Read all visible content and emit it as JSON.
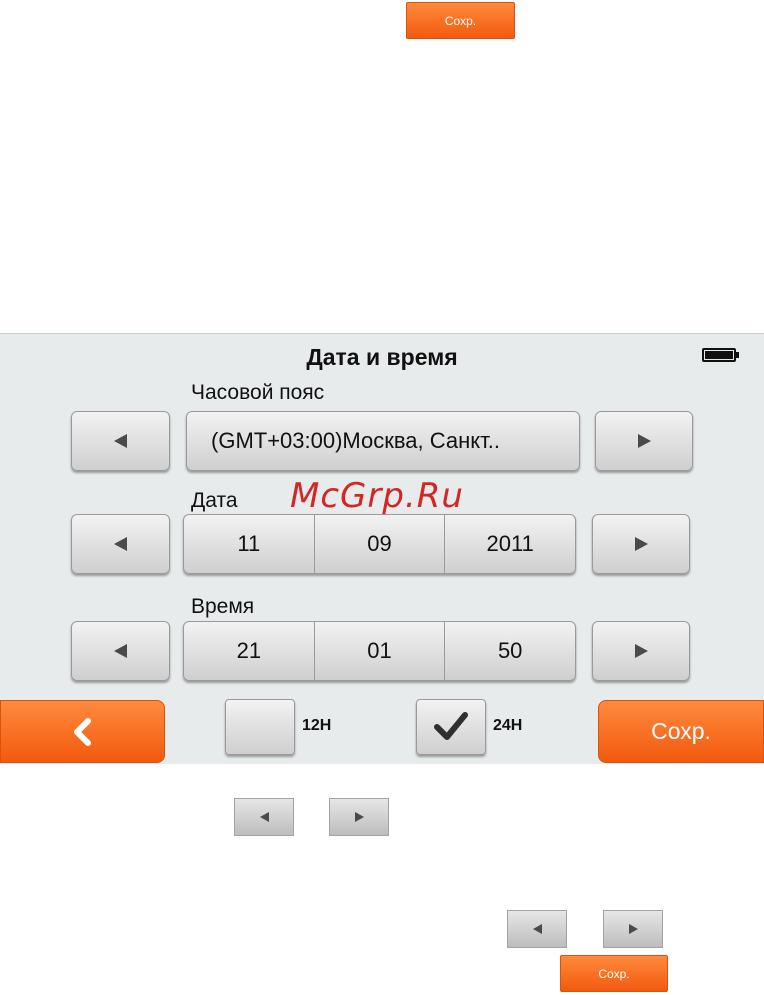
{
  "top_save_button": {
    "label": "Сохр."
  },
  "screen": {
    "title": "Дата и время",
    "timezone": {
      "label": "Часовой пояс",
      "value": "(GMT+03:00)Москва, Санкт.."
    },
    "date": {
      "label": "Дата",
      "day": "11",
      "month": "09",
      "year": "2011"
    },
    "time": {
      "label": "Время",
      "hours": "21",
      "minutes": "01",
      "seconds": "50"
    },
    "format_12h": {
      "label": "12H",
      "checked": false
    },
    "format_24h": {
      "label": "24H",
      "checked": true
    },
    "save_button": {
      "label": "Сохр."
    },
    "battery_level": 1.0
  },
  "watermark": "McGrp.Ru",
  "bottom_save_button": {
    "label": "Сохр."
  },
  "colors": {
    "accent_orange": "#f25a0e",
    "screen_background": "#e7ebeb",
    "watermark_red": "#d32626"
  },
  "icons": [
    "left-arrow-icon",
    "right-arrow-icon",
    "back-chevron-icon",
    "checkmark-icon",
    "battery-icon"
  ]
}
